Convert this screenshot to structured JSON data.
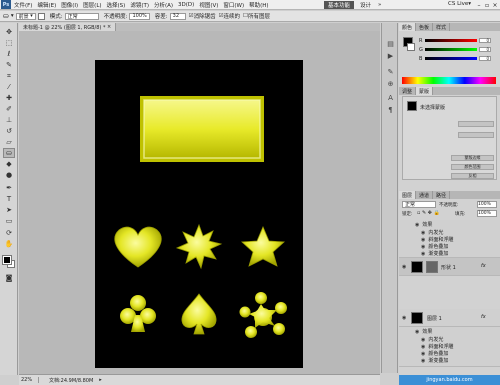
{
  "menu": {
    "logo": "Ps",
    "items": [
      "文件(F)",
      "编辑(E)",
      "图像(I)",
      "图层(L)",
      "选择(S)",
      "滤镜(T)",
      "分析(A)",
      "3D(D)",
      "视图(V)",
      "窗口(W)",
      "帮助(H)"
    ],
    "zoom_value": "22%",
    "workspace_active": "基本功能",
    "workspace_other": "设计",
    "cs_live": "CS Live▾"
  },
  "options": {
    "brush_label": "画笔:",
    "brush_value": "前景",
    "mode_label": "模式:",
    "mode_value": "正常",
    "opacity_label": "不透明度:",
    "opacity_value": "100%",
    "tolerance_label": "容差:",
    "tolerance_value": "32",
    "antialias_label": "消除锯齿",
    "contiguous_label": "连续的",
    "all_layers_label": "所有图层"
  },
  "document": {
    "tab_label": "未标题-1 @ 22% (图层 1, RGB/8) *"
  },
  "status": {
    "zoom": "22%",
    "doc_info": "文档:24.9M/8.80M"
  },
  "color_panel": {
    "tabs": [
      "颜色",
      "色板",
      "样式"
    ],
    "r_label": "R",
    "g_label": "G",
    "b_label": "B",
    "r_value": "0",
    "g_value": "0",
    "b_value": "0"
  },
  "adjust_panel": {
    "tabs": [
      "调整",
      "蒙版"
    ],
    "title": "未选择蒙版",
    "btn1": "选择: 像素",
    "btn2": "蒙版边缘",
    "btn3": "颜色范围",
    "btn4": "反相"
  },
  "layers_panel": {
    "tabs": [
      "图层",
      "通道",
      "路径"
    ],
    "mode": "正常",
    "opacity_label": "不透明度:",
    "opacity_value": "100%",
    "lock_label": "锁定:",
    "fill_label": "填充:",
    "fill_value": "100%",
    "effects_group_a": [
      "效果",
      "内发光",
      "斜面和浮雕",
      "颜色叠加",
      "渐变叠加"
    ],
    "shape_layer": "形状 1",
    "layer_name": "图层 1",
    "effects_group_b": [
      "效果",
      "内发光",
      "斜面和浮雕",
      "颜色叠加",
      "渐变叠加"
    ],
    "bottom_strip": "jingyan.baidu.com"
  },
  "colors": {
    "yellow": "#e8ea2a",
    "yellow_dark": "#9a9a00",
    "canvas_bg": "#000000"
  }
}
